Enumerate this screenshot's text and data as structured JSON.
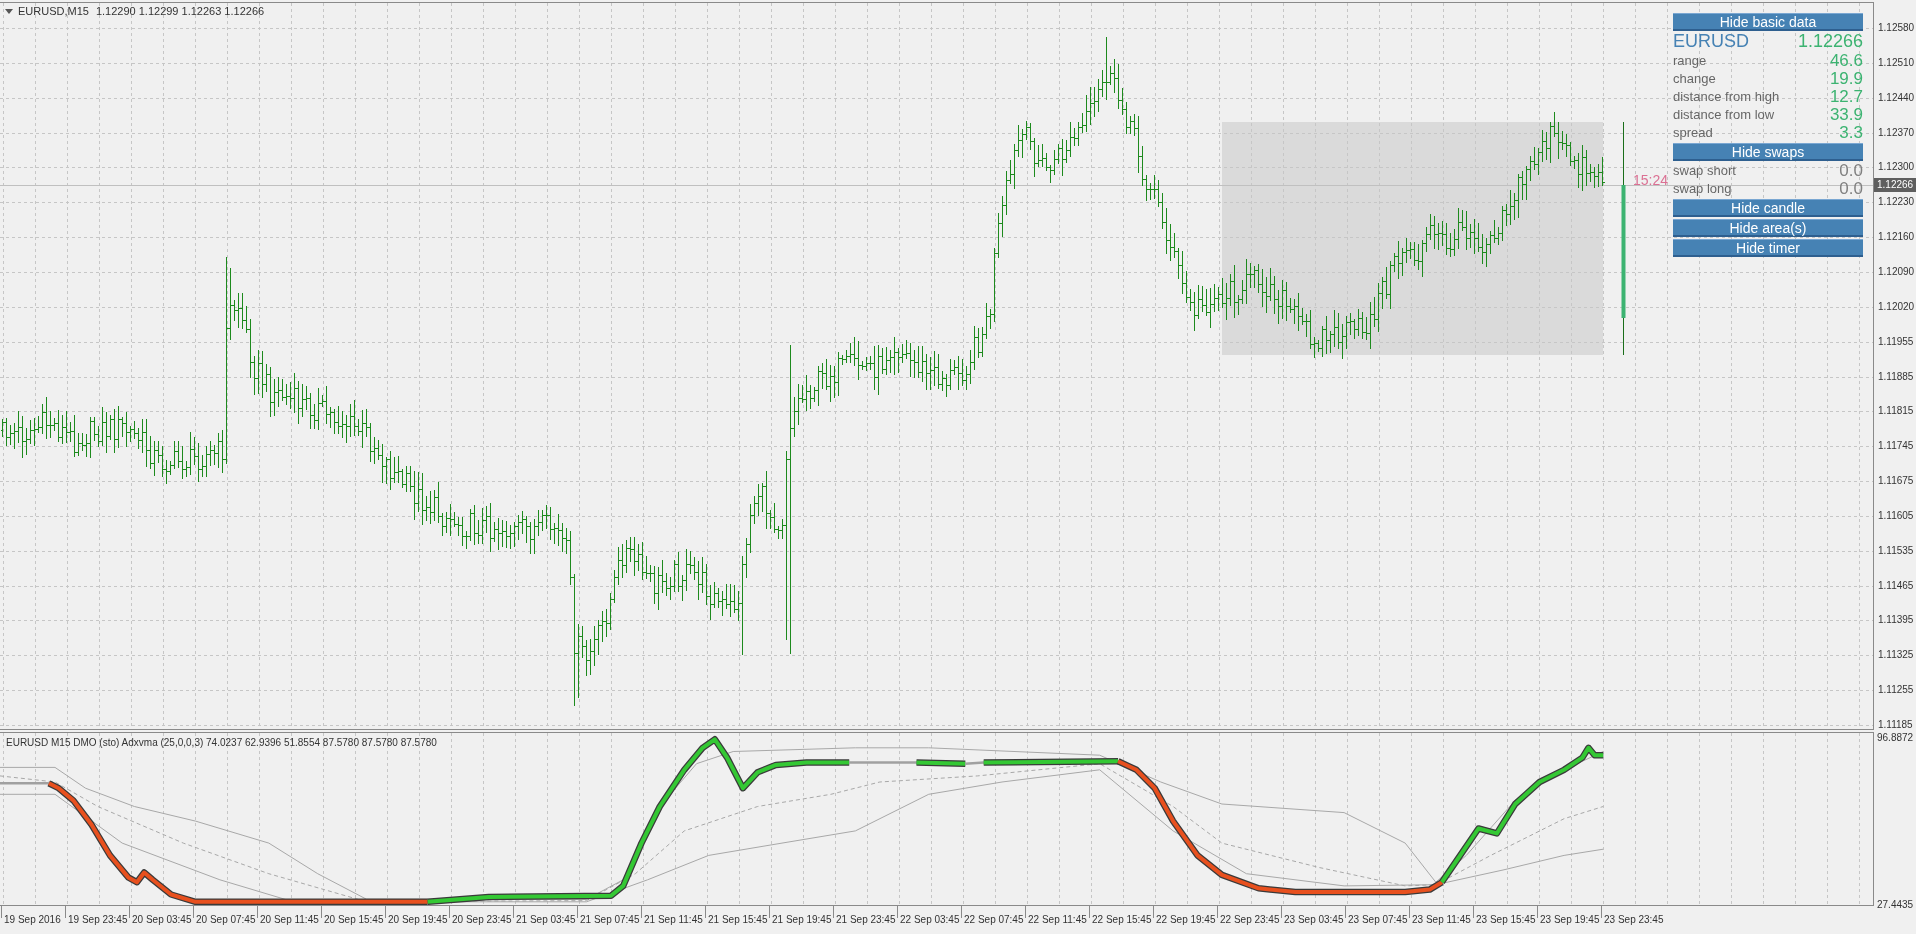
{
  "chart": {
    "symbol": "EURUSD,M15",
    "ohlc": "1.12290 1.12299 1.12263 1.12266",
    "timer": "15:24",
    "current_price": "1.12266",
    "price_axis": [
      "1.12580",
      "1.12510",
      "1.12440",
      "1.12370",
      "1.12300",
      "1.12230",
      "1.12160",
      "1.12090",
      "1.12020",
      "1.11955",
      "1.11885",
      "1.11815",
      "1.11745",
      "1.11675",
      "1.11605",
      "1.11535",
      "1.11465",
      "1.11395",
      "1.11325",
      "1.11255",
      "1.11185"
    ]
  },
  "info_panel": [
    {
      "kind": "button",
      "label": "Hide basic data"
    },
    {
      "kind": "symbol",
      "label": "EURUSD",
      "value": "1.12266",
      "color": "#3cb371"
    },
    {
      "kind": "row",
      "label": "range",
      "value": "46.6",
      "color": "#3cb371"
    },
    {
      "kind": "row",
      "label": "change",
      "value": "19.9",
      "color": "#3cb371"
    },
    {
      "kind": "row",
      "label": "distance from high",
      "value": "12.7",
      "color": "#3cb371"
    },
    {
      "kind": "row",
      "label": "distance from low",
      "value": "33.9",
      "color": "#3cb371"
    },
    {
      "kind": "row",
      "label": "spread",
      "value": "3.3",
      "color": "#3cb371"
    },
    {
      "kind": "button",
      "label": "Hide swaps"
    },
    {
      "kind": "row",
      "label": "swap short",
      "value": "0.0",
      "color": "#808080"
    },
    {
      "kind": "row",
      "label": "swap long",
      "value": "0.0",
      "color": "#808080"
    },
    {
      "kind": "button",
      "label": "Hide candle"
    },
    {
      "kind": "button",
      "label": "Hide area(s)"
    },
    {
      "kind": "button",
      "label": "Hide timer"
    }
  ],
  "indicator": {
    "title": "EURUSD M15 DMO (sto) Adxvma (25,0,0,3) 74.0237 62.9396 51.8554 87.5780 87.5780 87.5780",
    "axis_max": "96.8872",
    "axis_min": "27.4435"
  },
  "time_axis": [
    "19 Sep 2016",
    "19 Sep 23:45",
    "20 Sep 03:45",
    "20 Sep 07:45",
    "20 Sep 11:45",
    "20 Sep 15:45",
    "20 Sep 19:45",
    "20 Sep 23:45",
    "21 Sep 03:45",
    "21 Sep 07:45",
    "21 Sep 11:45",
    "21 Sep 15:45",
    "21 Sep 19:45",
    "21 Sep 23:45",
    "22 Sep 03:45",
    "22 Sep 07:45",
    "22 Sep 11:45",
    "22 Sep 15:45",
    "22 Sep 19:45",
    "22 Sep 23:45",
    "23 Sep 03:45",
    "23 Sep 07:45",
    "23 Sep 11:45",
    "23 Sep 15:45",
    "23 Sep 19:45",
    "23 Sep 23:45"
  ]
}
